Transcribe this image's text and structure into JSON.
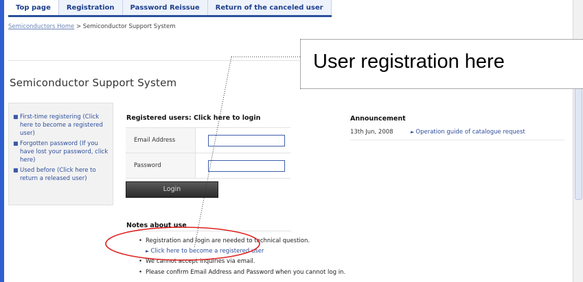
{
  "nav": {
    "tabs": [
      {
        "label": "Top page"
      },
      {
        "label": "Registration"
      },
      {
        "label": "Password Reissue"
      },
      {
        "label": "Return of the canceled user"
      }
    ]
  },
  "breadcrumb": {
    "home_link": "Semiconductors Home",
    "separator": ">",
    "current": "Semiconductor Support System"
  },
  "page": {
    "title": "Semiconductor Support System"
  },
  "callout": {
    "text": "User registration here"
  },
  "sidebar": {
    "items": [
      {
        "label": "First-time registering (Click here to become a registered user)"
      },
      {
        "label": "Forgotten password (If you have lost your password, click here)"
      },
      {
        "label": "Used before (Click here to return a released user)"
      }
    ]
  },
  "login": {
    "header": "Registered users: Click here to login",
    "email_label": "Email Address",
    "email_value": "",
    "password_label": "Password",
    "password_value": "",
    "button_label": "Login"
  },
  "notes": {
    "title": "Notes about use",
    "item1": "Registration and login are needed to technical question.",
    "link": "Click here to become a registered user",
    "item2": "We cannot accept inquiries via email.",
    "item3": "Please confirm Email Address and Password when you cannot log in."
  },
  "announcement": {
    "header": "Announcement",
    "items": [
      {
        "date": "13th Jun, 2008",
        "link": "Operation guide of catalogue request"
      }
    ]
  },
  "colors": {
    "frame_blue": "#2f5fd0",
    "nav_text": "#1c3f8c",
    "link_blue": "#2f4f9a",
    "annotation_red": "#e02020"
  },
  "icons": {
    "bullet": "square-bullet-icon",
    "link_arrow": "triangle-right-icon"
  }
}
